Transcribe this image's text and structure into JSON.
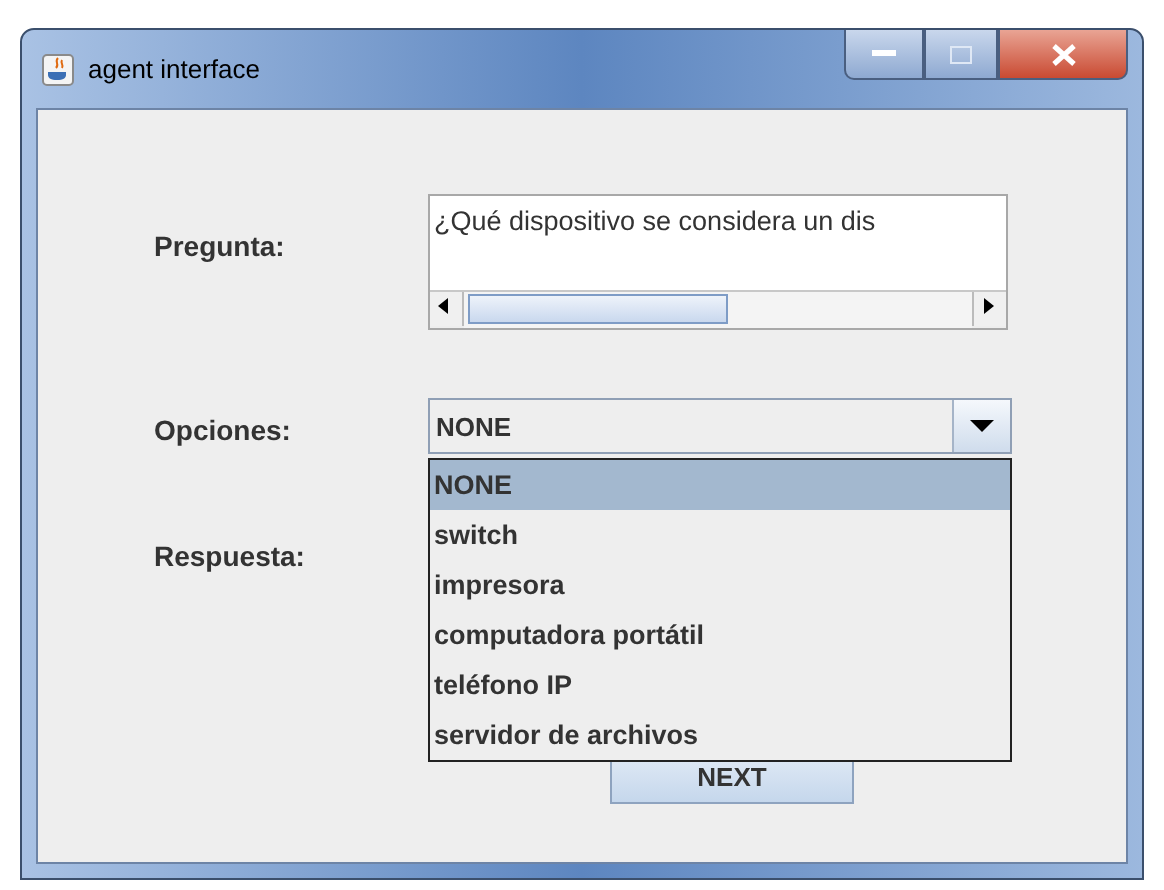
{
  "window": {
    "title": "agent interface"
  },
  "question": {
    "label": "Pregunta:",
    "text": "¿Qué dispositivo se considera un dis"
  },
  "options": {
    "label": "Opciones:",
    "value": "NONE",
    "expanded": true,
    "items": [
      {
        "label": "NONE",
        "selected": true
      },
      {
        "label": "switch",
        "selected": false
      },
      {
        "label": "impresora",
        "selected": false
      },
      {
        "label": "computadora portátil",
        "selected": false
      },
      {
        "label": "teléfono IP",
        "selected": false
      },
      {
        "label": "servidor de archivos",
        "selected": false
      }
    ]
  },
  "answer": {
    "label": "Respuesta:"
  },
  "button": {
    "label": "NEXT"
  }
}
